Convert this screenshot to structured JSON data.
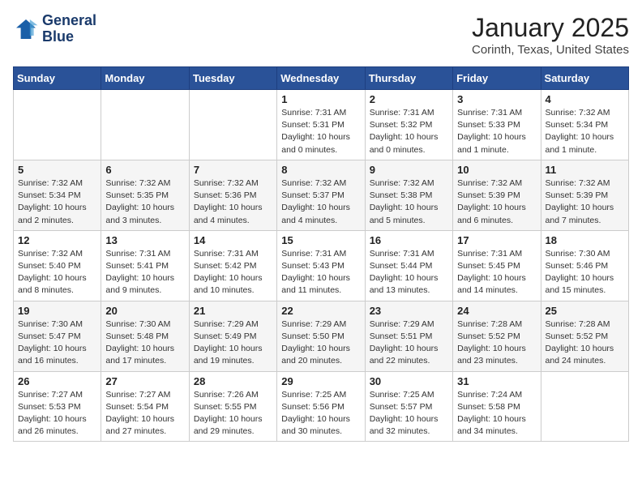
{
  "header": {
    "logo_line1": "General",
    "logo_line2": "Blue",
    "month": "January 2025",
    "location": "Corinth, Texas, United States"
  },
  "weekdays": [
    "Sunday",
    "Monday",
    "Tuesday",
    "Wednesday",
    "Thursday",
    "Friday",
    "Saturday"
  ],
  "weeks": [
    [
      {
        "day": "",
        "sunrise": "",
        "sunset": "",
        "daylight": ""
      },
      {
        "day": "",
        "sunrise": "",
        "sunset": "",
        "daylight": ""
      },
      {
        "day": "",
        "sunrise": "",
        "sunset": "",
        "daylight": ""
      },
      {
        "day": "1",
        "sunrise": "Sunrise: 7:31 AM",
        "sunset": "Sunset: 5:31 PM",
        "daylight": "Daylight: 10 hours and 0 minutes."
      },
      {
        "day": "2",
        "sunrise": "Sunrise: 7:31 AM",
        "sunset": "Sunset: 5:32 PM",
        "daylight": "Daylight: 10 hours and 0 minutes."
      },
      {
        "day": "3",
        "sunrise": "Sunrise: 7:31 AM",
        "sunset": "Sunset: 5:33 PM",
        "daylight": "Daylight: 10 hours and 1 minute."
      },
      {
        "day": "4",
        "sunrise": "Sunrise: 7:32 AM",
        "sunset": "Sunset: 5:34 PM",
        "daylight": "Daylight: 10 hours and 1 minute."
      }
    ],
    [
      {
        "day": "5",
        "sunrise": "Sunrise: 7:32 AM",
        "sunset": "Sunset: 5:34 PM",
        "daylight": "Daylight: 10 hours and 2 minutes."
      },
      {
        "day": "6",
        "sunrise": "Sunrise: 7:32 AM",
        "sunset": "Sunset: 5:35 PM",
        "daylight": "Daylight: 10 hours and 3 minutes."
      },
      {
        "day": "7",
        "sunrise": "Sunrise: 7:32 AM",
        "sunset": "Sunset: 5:36 PM",
        "daylight": "Daylight: 10 hours and 4 minutes."
      },
      {
        "day": "8",
        "sunrise": "Sunrise: 7:32 AM",
        "sunset": "Sunset: 5:37 PM",
        "daylight": "Daylight: 10 hours and 4 minutes."
      },
      {
        "day": "9",
        "sunrise": "Sunrise: 7:32 AM",
        "sunset": "Sunset: 5:38 PM",
        "daylight": "Daylight: 10 hours and 5 minutes."
      },
      {
        "day": "10",
        "sunrise": "Sunrise: 7:32 AM",
        "sunset": "Sunset: 5:39 PM",
        "daylight": "Daylight: 10 hours and 6 minutes."
      },
      {
        "day": "11",
        "sunrise": "Sunrise: 7:32 AM",
        "sunset": "Sunset: 5:39 PM",
        "daylight": "Daylight: 10 hours and 7 minutes."
      }
    ],
    [
      {
        "day": "12",
        "sunrise": "Sunrise: 7:32 AM",
        "sunset": "Sunset: 5:40 PM",
        "daylight": "Daylight: 10 hours and 8 minutes."
      },
      {
        "day": "13",
        "sunrise": "Sunrise: 7:31 AM",
        "sunset": "Sunset: 5:41 PM",
        "daylight": "Daylight: 10 hours and 9 minutes."
      },
      {
        "day": "14",
        "sunrise": "Sunrise: 7:31 AM",
        "sunset": "Sunset: 5:42 PM",
        "daylight": "Daylight: 10 hours and 10 minutes."
      },
      {
        "day": "15",
        "sunrise": "Sunrise: 7:31 AM",
        "sunset": "Sunset: 5:43 PM",
        "daylight": "Daylight: 10 hours and 11 minutes."
      },
      {
        "day": "16",
        "sunrise": "Sunrise: 7:31 AM",
        "sunset": "Sunset: 5:44 PM",
        "daylight": "Daylight: 10 hours and 13 minutes."
      },
      {
        "day": "17",
        "sunrise": "Sunrise: 7:31 AM",
        "sunset": "Sunset: 5:45 PM",
        "daylight": "Daylight: 10 hours and 14 minutes."
      },
      {
        "day": "18",
        "sunrise": "Sunrise: 7:30 AM",
        "sunset": "Sunset: 5:46 PM",
        "daylight": "Daylight: 10 hours and 15 minutes."
      }
    ],
    [
      {
        "day": "19",
        "sunrise": "Sunrise: 7:30 AM",
        "sunset": "Sunset: 5:47 PM",
        "daylight": "Daylight: 10 hours and 16 minutes."
      },
      {
        "day": "20",
        "sunrise": "Sunrise: 7:30 AM",
        "sunset": "Sunset: 5:48 PM",
        "daylight": "Daylight: 10 hours and 17 minutes."
      },
      {
        "day": "21",
        "sunrise": "Sunrise: 7:29 AM",
        "sunset": "Sunset: 5:49 PM",
        "daylight": "Daylight: 10 hours and 19 minutes."
      },
      {
        "day": "22",
        "sunrise": "Sunrise: 7:29 AM",
        "sunset": "Sunset: 5:50 PM",
        "daylight": "Daylight: 10 hours and 20 minutes."
      },
      {
        "day": "23",
        "sunrise": "Sunrise: 7:29 AM",
        "sunset": "Sunset: 5:51 PM",
        "daylight": "Daylight: 10 hours and 22 minutes."
      },
      {
        "day": "24",
        "sunrise": "Sunrise: 7:28 AM",
        "sunset": "Sunset: 5:52 PM",
        "daylight": "Daylight: 10 hours and 23 minutes."
      },
      {
        "day": "25",
        "sunrise": "Sunrise: 7:28 AM",
        "sunset": "Sunset: 5:52 PM",
        "daylight": "Daylight: 10 hours and 24 minutes."
      }
    ],
    [
      {
        "day": "26",
        "sunrise": "Sunrise: 7:27 AM",
        "sunset": "Sunset: 5:53 PM",
        "daylight": "Daylight: 10 hours and 26 minutes."
      },
      {
        "day": "27",
        "sunrise": "Sunrise: 7:27 AM",
        "sunset": "Sunset: 5:54 PM",
        "daylight": "Daylight: 10 hours and 27 minutes."
      },
      {
        "day": "28",
        "sunrise": "Sunrise: 7:26 AM",
        "sunset": "Sunset: 5:55 PM",
        "daylight": "Daylight: 10 hours and 29 minutes."
      },
      {
        "day": "29",
        "sunrise": "Sunrise: 7:25 AM",
        "sunset": "Sunset: 5:56 PM",
        "daylight": "Daylight: 10 hours and 30 minutes."
      },
      {
        "day": "30",
        "sunrise": "Sunrise: 7:25 AM",
        "sunset": "Sunset: 5:57 PM",
        "daylight": "Daylight: 10 hours and 32 minutes."
      },
      {
        "day": "31",
        "sunrise": "Sunrise: 7:24 AM",
        "sunset": "Sunset: 5:58 PM",
        "daylight": "Daylight: 10 hours and 34 minutes."
      },
      {
        "day": "",
        "sunrise": "",
        "sunset": "",
        "daylight": ""
      }
    ]
  ]
}
